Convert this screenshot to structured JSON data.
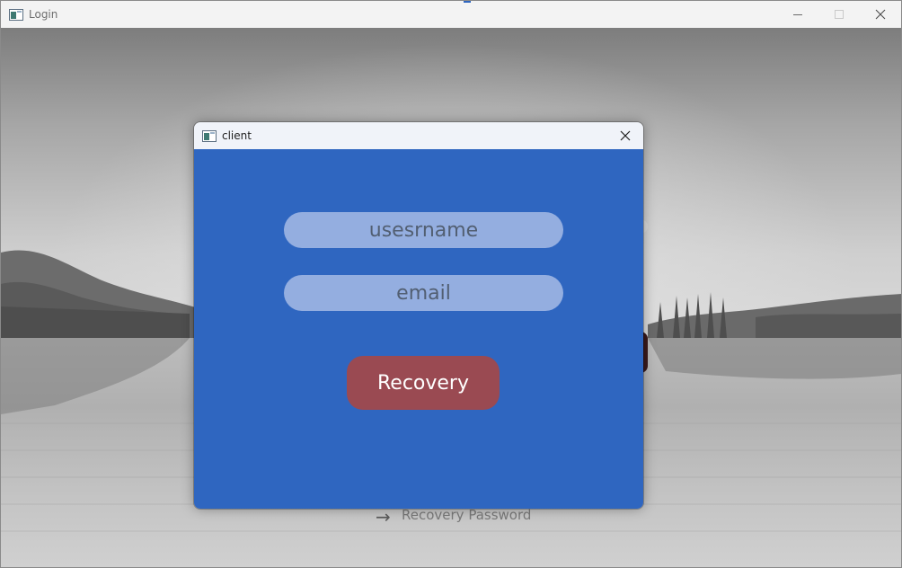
{
  "main_window": {
    "title": "Login",
    "controls": {
      "minimize": "minimize-icon",
      "maximize": "maximize-icon",
      "close": "close-icon"
    }
  },
  "background_form": {
    "link_text": "Recovery Password",
    "link_icon": "arrow-right-icon"
  },
  "dialog": {
    "title": "client",
    "username_placeholder": "usesrname",
    "email_placeholder": "email",
    "recovery_label": "Recovery",
    "close_icon": "close-icon"
  },
  "colors": {
    "dialog_background": "#2f66c0",
    "input_background": "#94aee0",
    "button_background": "#9a4a52",
    "button_text": "#ffffff"
  }
}
